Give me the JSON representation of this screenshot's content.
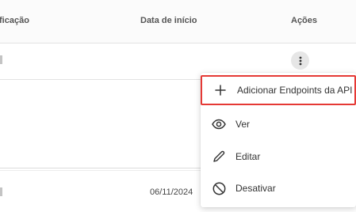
{
  "table": {
    "headers": {
      "classificacao": "ficação",
      "data_inicio": "Data de início",
      "acoes": "Ações"
    },
    "rows": [
      {
        "data_inicio": ""
      },
      {
        "data_inicio": ""
      },
      {
        "data_inicio": "06/11/2024"
      }
    ]
  },
  "actions_menu": {
    "items": [
      {
        "label": "Adicionar Endpoints da API",
        "icon": "plus-icon"
      },
      {
        "label": "Ver",
        "icon": "eye-icon"
      },
      {
        "label": "Editar",
        "icon": "pencil-icon"
      },
      {
        "label": "Desativar",
        "icon": "block-icon"
      }
    ],
    "highlight_color": "#e53935"
  }
}
